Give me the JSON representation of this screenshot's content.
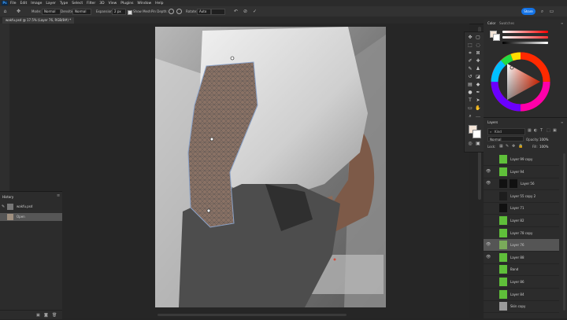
{
  "menu": {
    "logo": "Ps",
    "items": [
      "File",
      "Edit",
      "Image",
      "Layer",
      "Type",
      "Select",
      "Filter",
      "3D",
      "View",
      "Plugins",
      "Window",
      "Help"
    ]
  },
  "options_bar": {
    "mode_label": "Mode:",
    "mode_value": "Normal",
    "density_label": "Densities:",
    "density_value": "Normal",
    "expansion_label": "Expansion:",
    "expansion_value": "2 px",
    "show_mesh": "Show Mesh",
    "pin_depth_label": "Pin Depth:",
    "rotate_label": "Rotate:",
    "rotate_value": "Auto",
    "share": "Share"
  },
  "document_tab": {
    "title": "wakfu.psd @ 17.5% (Layer 76, RGB/8#) *"
  },
  "history": {
    "title": "History",
    "snapshot_label": "wakfu.psd",
    "items": [
      {
        "label": "Open",
        "selected": true
      }
    ]
  },
  "color_panel": {
    "tabs": [
      "Color",
      "Swatches"
    ],
    "foreground": "#f3e4d7",
    "background": "#ffffff"
  },
  "layers_panel": {
    "title": "Layers",
    "kind_label": "Kind",
    "blend_mode": "Normal",
    "opacity_label": "Opacity:",
    "opacity_value": "100%",
    "lock_label": "Lock:",
    "fill_label": "Fill:",
    "fill_value": "100%",
    "layers": [
      {
        "name": "Layer 99 copy",
        "visible": false,
        "thumb": "#5fbf3a"
      },
      {
        "name": "Layer 94",
        "visible": true,
        "thumb": "#5fbf3a"
      },
      {
        "name": "Layer 56",
        "visible": true,
        "thumb": "#111111",
        "mask": true
      },
      {
        "name": "Layer 55 copy 2",
        "visible": false,
        "thumb": "#1d1d1d"
      },
      {
        "name": "Layer 71",
        "visible": false,
        "thumb": "#111111"
      },
      {
        "name": "Layer 82",
        "visible": false,
        "thumb": "#5fbf3a"
      },
      {
        "name": "Layer 78 copy",
        "visible": false,
        "thumb": "#5fbf3a"
      },
      {
        "name": "Layer 76",
        "visible": true,
        "thumb": "#7aaa5a",
        "selected": true
      },
      {
        "name": "Layer 88",
        "visible": true,
        "thumb": "#5fbf3a"
      },
      {
        "name": "Band",
        "visible": false,
        "thumb": "#5fbf3a"
      },
      {
        "name": "Layer 86",
        "visible": false,
        "thumb": "#5fbf3a"
      },
      {
        "name": "Layer 84",
        "visible": false,
        "thumb": "#5fbf3a"
      },
      {
        "name": "Skin copy",
        "visible": false,
        "thumb": "#9a9a9a"
      }
    ]
  }
}
